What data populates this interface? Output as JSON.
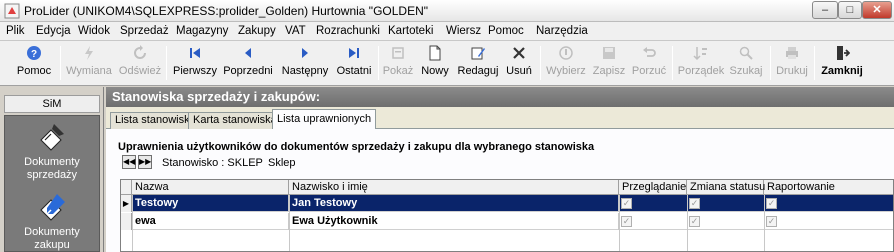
{
  "window": {
    "title": "ProLider  (UNIKOM4\\SQLEXPRESS:prolider_Golden) Hurtownia \"GOLDEN\"",
    "min_label": "–",
    "max_label": "□",
    "close_label": "✕"
  },
  "menu": [
    "Plik",
    "Edycja",
    "Widok",
    "Sprzedaż",
    "Magazyny",
    "Zakupy",
    "VAT",
    "Rozrachunki",
    "Kartoteki",
    "Wiersz",
    "Pomoc",
    "Narzędzia"
  ],
  "toolbar": {
    "pomoc": "Pomoc",
    "wymiana": "Wymiana",
    "odswiez": "Odśwież",
    "pierwszy": "Pierwszy",
    "poprzedni": "Poprzedni",
    "nastepny": "Następny",
    "ostatni": "Ostatni",
    "pokaz": "Pokaż",
    "nowy": "Nowy",
    "redaguj": "Redaguj",
    "usun": "Usuń",
    "wybierz": "Wybierz",
    "zapisz": "Zapisz",
    "porzuc": "Porzuć",
    "porzadek": "Porządek",
    "szukaj": "Szukaj",
    "drukuj": "Drukuj",
    "zamknij": "Zamknij"
  },
  "sidebar": {
    "tab": "SiM",
    "items": [
      "Dokumenty sprzedaży",
      "Dokumenty zakupu"
    ]
  },
  "main": {
    "header": "Stanowiska sprzedaży i zakupów:",
    "tabs": [
      "Lista stanowisk",
      "Karta stanowiska",
      "Lista uprawnionych"
    ],
    "section_title": "Uprawnienia użytkowników do dokumentów sprzedaży i zakupu dla wybranego stanowiska",
    "stanowisko_label": "Stanowisko : SKLEP",
    "stanowisko_name": "Sklep"
  },
  "grid": {
    "columns": [
      "Nazwa",
      "Nazwisko i imię",
      "Przeglądanie",
      "Zmiana statusu",
      "Raportowanie"
    ],
    "rows": [
      {
        "nazwa": "Testowy",
        "nazwisko": "Jan Testowy",
        "przegladanie": true,
        "zmiana": true,
        "raportowanie": true
      },
      {
        "nazwa": "ewa",
        "nazwisko": "Ewa Użytkownik",
        "przegladanie": true,
        "zmiana": true,
        "raportowanie": true
      }
    ]
  },
  "colors": {
    "selection": "#0a246a",
    "header_bar": "#7a7a7a",
    "sidebar_bg": "#7a7a7a"
  }
}
